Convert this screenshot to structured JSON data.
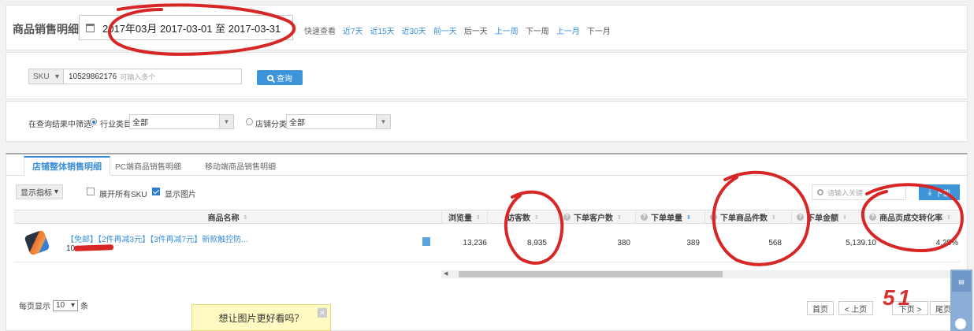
{
  "header": {
    "title": "商品销售明细",
    "date_range": "2017年03月 2017-03-01 至 2017-03-31",
    "quick_label": "快速查看",
    "quick_links": [
      "近7天",
      "近15天",
      "近30天",
      "前一天",
      "后一天",
      "上一周",
      "下一周",
      "上一月",
      "下一月"
    ]
  },
  "search": {
    "type": "SKU",
    "value": "10529862176",
    "placeholder": "可输入多个",
    "button": "查询"
  },
  "filter": {
    "label": "在查询结果中筛选:",
    "option1": "行业类目",
    "option1_value": "全部",
    "option2": "店铺分类",
    "option2_value": "全部"
  },
  "tabs": [
    "店铺整体销售明细",
    "PC端商品销售明细",
    "移动端商品销售明细"
  ],
  "toolbar": {
    "metrics": "显示指标",
    "expand_sku": "展开所有SKU",
    "show_image": "显示图片",
    "keyword_placeholder": "请输入关键",
    "export": "下载"
  },
  "table": {
    "columns": [
      "商品名称",
      "浏览量",
      "访客数",
      "下单客户数",
      "下单单量",
      "下单商品件数",
      "下单金额",
      "商品页成交转化率"
    ],
    "row": {
      "title": "【免邮】【2件再减3元】【3件再减7元】新款触控防...",
      "id_prefix": "10",
      "values": [
        "13,236",
        "8,935",
        "380",
        "389",
        "568",
        "5,139.10",
        "4.25%"
      ]
    }
  },
  "pagination": {
    "per_page_label": "每页显示",
    "per_page": "10",
    "unit": "条",
    "first": "首页",
    "prev": "< 上页",
    "next": "下页 >",
    "last": "尾页"
  },
  "tooltip": "想让图片更好看吗？",
  "watermark": "51",
  "colors": {
    "accent": "#3a8ed8",
    "annotation": "#d72626"
  }
}
